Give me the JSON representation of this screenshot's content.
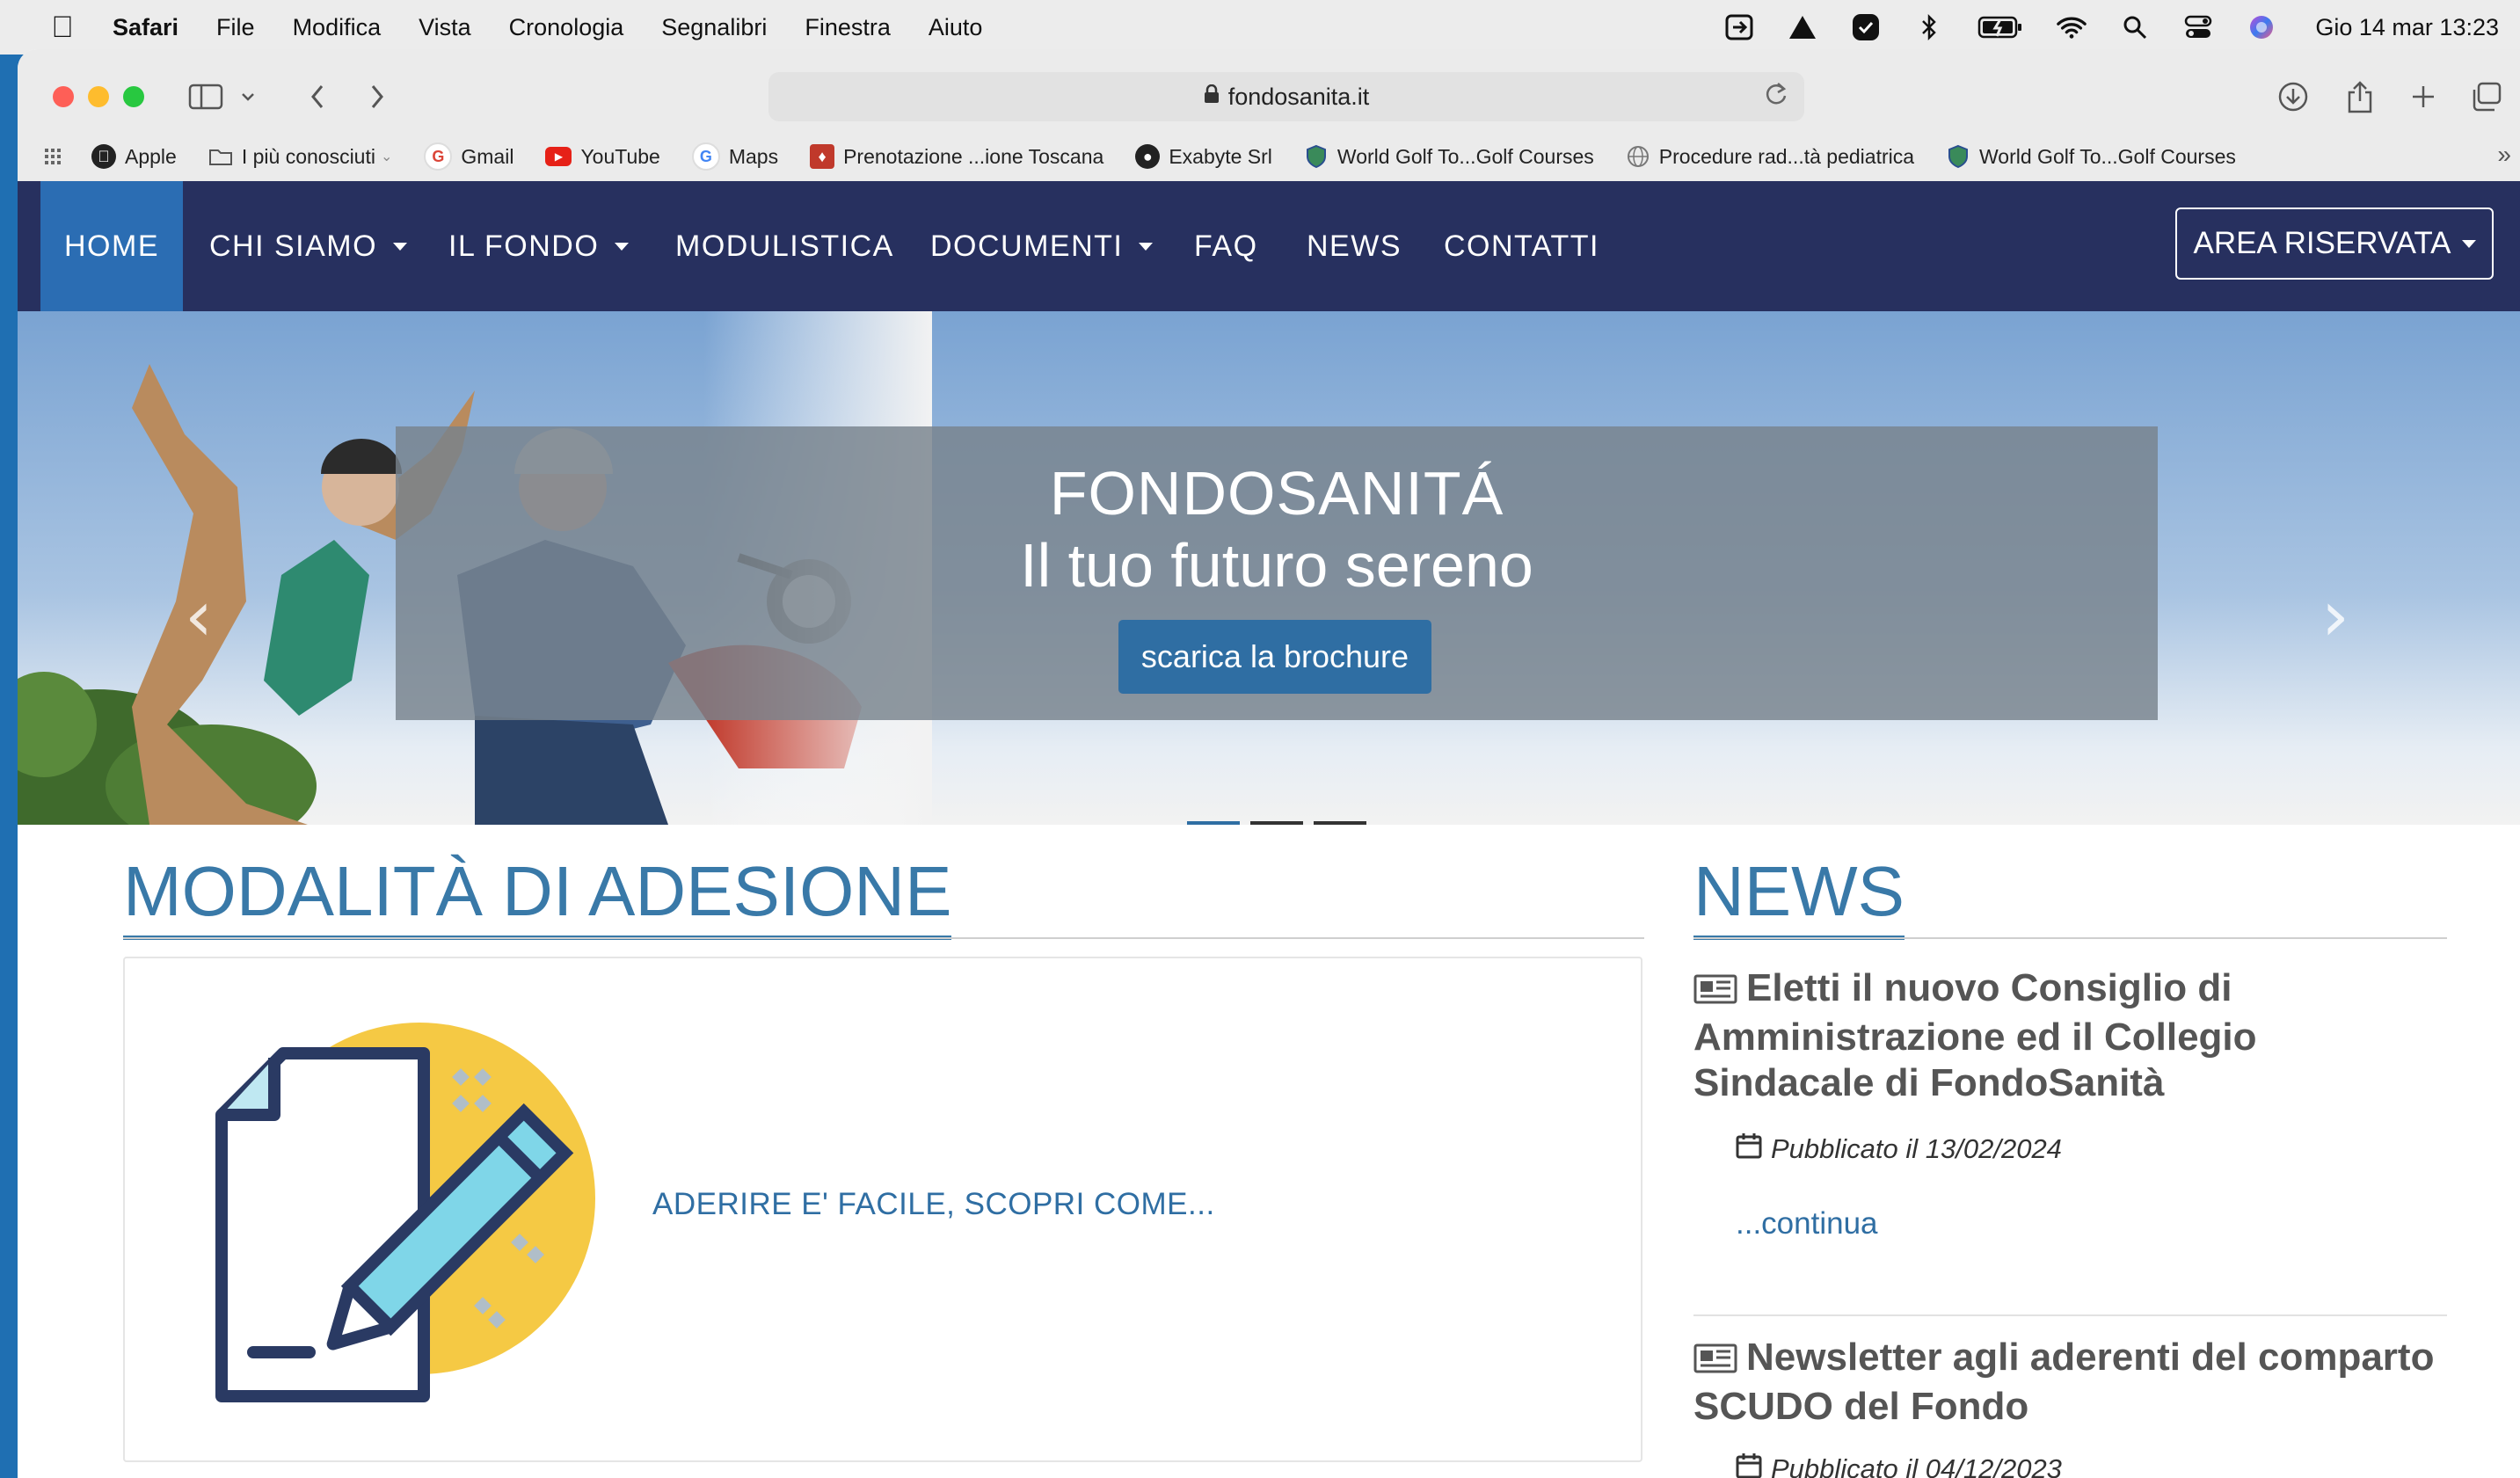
{
  "menubar": {
    "app": "Safari",
    "items": [
      "File",
      "Modifica",
      "Vista",
      "Cronologia",
      "Segnalibri",
      "Finestra",
      "Aiuto"
    ],
    "status_icons": [
      "screen-share-icon",
      "drive-icon",
      "checklist-icon",
      "bluetooth-icon",
      "battery-icon",
      "wifi-icon",
      "spotlight-icon",
      "control-center-icon",
      "siri-icon"
    ],
    "clock": "Gio 14 mar  13:23"
  },
  "browser": {
    "url": "fondosanita.it",
    "bookmarks": [
      {
        "label": "Apple",
        "icon": "apple-icon"
      },
      {
        "label": "I più conosciuti",
        "icon": "folder-icon"
      },
      {
        "label": "Gmail",
        "icon": "google-icon"
      },
      {
        "label": "YouTube",
        "icon": "youtube-icon"
      },
      {
        "label": "Maps",
        "icon": "google-icon"
      },
      {
        "label": "Prenotazione ...ione Toscana",
        "icon": "toscana-icon"
      },
      {
        "label": "Exabyte Srl",
        "icon": "exabyte-icon"
      },
      {
        "label": "World Golf To...Golf Courses",
        "icon": "shield-icon"
      },
      {
        "label": "Procedure rad...tà pediatrica",
        "icon": "globe-icon"
      },
      {
        "label": "World Golf To...Golf Courses",
        "icon": "shield-icon"
      }
    ]
  },
  "nav": {
    "home": "HOME",
    "chi_siamo": "CHI SIAMO",
    "il_fondo": "IL FONDO",
    "modulistica": "MODULISTICA",
    "documenti": "DOCUMENTI",
    "faq": "FAQ",
    "news": "NEWS",
    "contatti": "CONTATTI",
    "area_riservata": "AREA RISERVATA"
  },
  "hero": {
    "title": "FONDOSANITÁ",
    "subtitle": "Il tuo futuro sereno",
    "button": "scarica la brochure",
    "slide_count": 3,
    "active_slide": 1
  },
  "modalita": {
    "heading": "MODALITÀ DI ADESIONE",
    "link": "ADERIRE E' FACILE, SCOPRI COME..."
  },
  "news": {
    "heading": "NEWS",
    "items": [
      {
        "title": "Eletti il nuovo Consiglio di Amministrazione ed il Collegio Sindacale di FondoSanità",
        "date": "Pubblicato il 13/02/2024",
        "more": "...continua"
      },
      {
        "title": "Newsletter agli aderenti del comparto SCUDO del Fondo",
        "date": "Pubblicato il 04/12/2023"
      }
    ]
  },
  "colors": {
    "nav_bg": "#27305f",
    "nav_active": "#2b6db3",
    "accent": "#3979a8",
    "button": "#2f6ea3"
  }
}
